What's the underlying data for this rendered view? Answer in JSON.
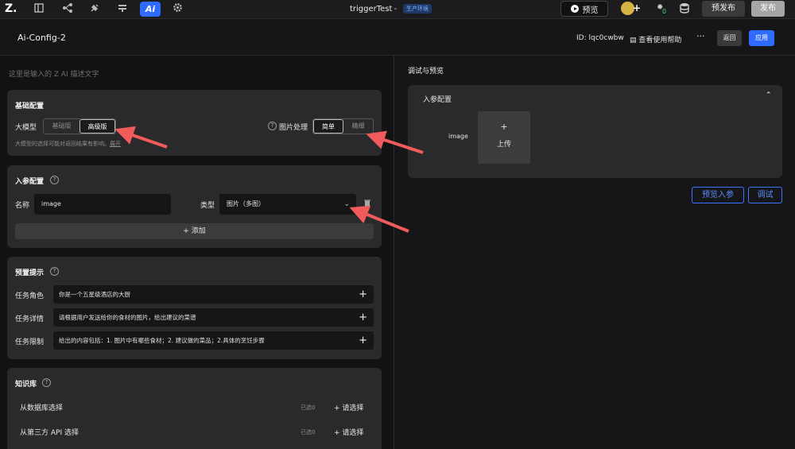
{
  "topbar": {
    "logo": "Z.",
    "app_title": "triggerTest",
    "env_badge": "生产环境",
    "ai_label": "Ai",
    "preview_label": "预览",
    "bug_count": "0",
    "prepublish_label": "预发布",
    "publish_label": "发布"
  },
  "header": {
    "title": "Ai-Config-2",
    "id_text": "ID: lqc0cwbw",
    "help_label": "查看使用帮助",
    "more": "···",
    "back_label": "返回",
    "apply_label": "应用"
  },
  "left": {
    "ai_description_placeholder": "这里是输入的 Z AI 描述文字",
    "basic": {
      "title": "基础配置",
      "model_label": "大模型",
      "model_options": [
        "基础版",
        "高级版"
      ],
      "model_selected": "高级版",
      "image_label": "图片处理",
      "image_options": [
        "简单",
        "精细"
      ],
      "image_selected": "简单",
      "hint": "大模型的选择可能对返回结果有影响。",
      "hint_link": "展开"
    },
    "params": {
      "title": "入参配置",
      "name_label": "名称",
      "name_value": "image",
      "type_label": "类型",
      "type_value": "图片（多图）",
      "add_label": "+ 添加"
    },
    "prompts": {
      "title": "预置提示",
      "rows": [
        {
          "label": "任务角色",
          "value": "你是一个五星级酒店的大厨"
        },
        {
          "label": "任务详情",
          "value": "请根据用户发送给你的食材的图片，给出建议的菜谱"
        },
        {
          "label": "任务限制",
          "value": "给出的内容包括：1. 图片中有哪些食材；2. 建议做的菜品；2.具体的烹饪步骤"
        }
      ]
    },
    "knowledge": {
      "title": "知识库",
      "rows": [
        {
          "label": "从数据库选择",
          "count": "已选0",
          "action": "+ 请选择"
        },
        {
          "label": "从第三方 API 选择",
          "count": "已选0",
          "action": "+ 请选择"
        }
      ]
    }
  },
  "right": {
    "title": "调试与预览",
    "panel_title": "入参配置",
    "field_label": "image",
    "upload_plus": "+",
    "upload_label": "上传",
    "preview_params_label": "预览入参",
    "debug_label": "调试"
  }
}
